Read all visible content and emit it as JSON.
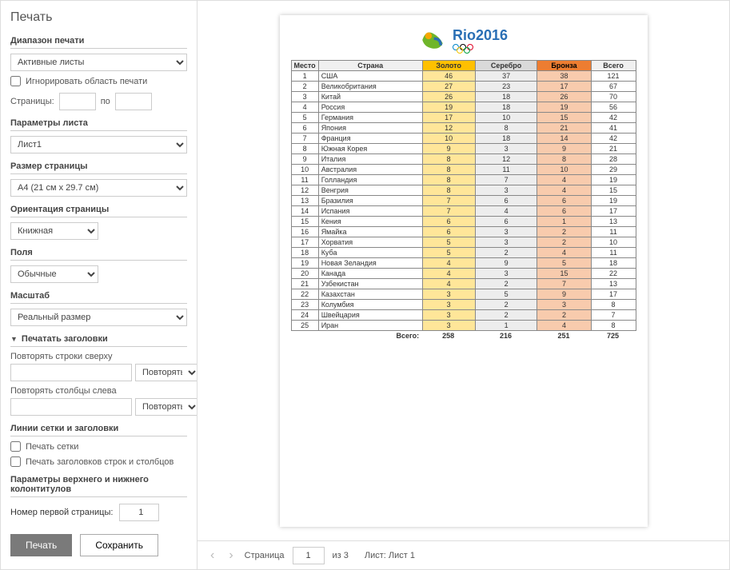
{
  "sidebar": {
    "title": "Печать",
    "range_heading": "Диапазон печати",
    "range_select": "Активные листы",
    "ignore_area": "Игнорировать область печати",
    "pages_label": "Страницы:",
    "pages_to": "по",
    "sheet_params": "Параметры листа",
    "sheet_name": "Лист1",
    "page_size_heading": "Размер страницы",
    "page_size": "A4 (21 см x 29.7 см)",
    "orientation_heading": "Ориентация страницы",
    "orientation": "Книжная",
    "margins_heading": "Поля",
    "margins": "Обычные",
    "scale_heading": "Масштаб",
    "scale": "Реальный размер",
    "print_titles": "Печатать заголовки",
    "repeat_rows": "Повторять строки сверху",
    "repeat_cols": "Повторять столбцы слева",
    "repeat_btn": "Повторять...",
    "gridlines_heading": "Линии сетки и заголовки",
    "print_grid": "Печать сетки",
    "print_headings": "Печать заголовков строк и столбцов",
    "hf_heading": "Параметры верхнего и нижнего колонтитулов",
    "first_page_label": "Номер первой страницы:",
    "first_page_value": "1",
    "print_btn": "Печать",
    "save_btn": "Сохранить"
  },
  "pager": {
    "page_label": "Страница",
    "page_value": "1",
    "of_label": "из 3",
    "sheet_label": "Лист: Лист 1"
  },
  "logo_text": "Rio2016",
  "chart_data": {
    "type": "table",
    "headers": [
      "Место",
      "Страна",
      "Золото",
      "Серебро",
      "Бронза",
      "Всего"
    ],
    "rows": [
      [
        1,
        "США",
        46,
        37,
        38,
        121
      ],
      [
        2,
        "Великобритания",
        27,
        23,
        17,
        67
      ],
      [
        3,
        "Китай",
        26,
        18,
        26,
        70
      ],
      [
        4,
        "Россия",
        19,
        18,
        19,
        56
      ],
      [
        5,
        "Германия",
        17,
        10,
        15,
        42
      ],
      [
        6,
        "Япония",
        12,
        8,
        21,
        41
      ],
      [
        7,
        "Франция",
        10,
        18,
        14,
        42
      ],
      [
        8,
        "Южная Корея",
        9,
        3,
        9,
        21
      ],
      [
        9,
        "Италия",
        8,
        12,
        8,
        28
      ],
      [
        10,
        "Австралия",
        8,
        11,
        10,
        29
      ],
      [
        11,
        "Голландия",
        8,
        7,
        4,
        19
      ],
      [
        12,
        "Венгрия",
        8,
        3,
        4,
        15
      ],
      [
        13,
        "Бразилия",
        7,
        6,
        6,
        19
      ],
      [
        14,
        "Испания",
        7,
        4,
        6,
        17
      ],
      [
        15,
        "Кения",
        6,
        6,
        1,
        13
      ],
      [
        16,
        "Ямайка",
        6,
        3,
        2,
        11
      ],
      [
        17,
        "Хорватия",
        5,
        3,
        2,
        10
      ],
      [
        18,
        "Куба",
        5,
        2,
        4,
        11
      ],
      [
        19,
        "Новая Зеландия",
        4,
        9,
        5,
        18
      ],
      [
        20,
        "Канада",
        4,
        3,
        15,
        22
      ],
      [
        21,
        "Узбекистан",
        4,
        2,
        7,
        13
      ],
      [
        22,
        "Казахстан",
        3,
        5,
        9,
        17
      ],
      [
        23,
        "Колумбия",
        3,
        2,
        3,
        8
      ],
      [
        24,
        "Швейцария",
        3,
        2,
        2,
        7
      ],
      [
        25,
        "Иран",
        3,
        1,
        4,
        8
      ]
    ],
    "totals_label": "Всего:",
    "totals": [
      258,
      216,
      251,
      725
    ]
  }
}
